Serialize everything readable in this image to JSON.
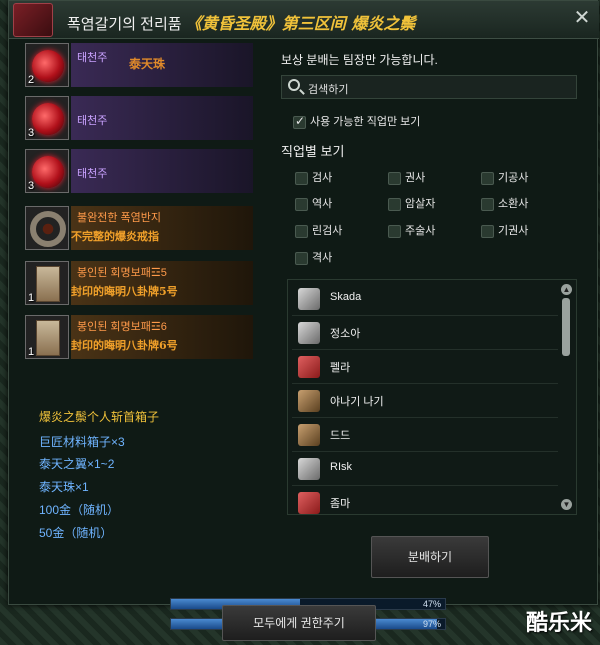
{
  "title": {
    "ko": "폭염갈기의 전리품",
    "zh": "《黄昏圣殿》第三区间 爆炎之鬃"
  },
  "loot": [
    {
      "qty": "2",
      "name": "태천주",
      "zh": "泰天珠"
    },
    {
      "qty": "3",
      "name": "태천주",
      "zh": ""
    },
    {
      "qty": "3",
      "name": "태천주",
      "zh": ""
    },
    {
      "qty": "",
      "name": "불완전한 폭염반지",
      "zh": "不完整的爆炎戒指"
    },
    {
      "qty": "1",
      "name": "봉인된 회명보패☲5",
      "zh": "封印的晦明八卦牌5号"
    },
    {
      "qty": "1",
      "name": "봉인된 회명보패☲6",
      "zh": "封印的晦明八卦牌6号"
    }
  ],
  "rewards": [
    "爆炎之鬃个人斩首箱子",
    "巨匠材料箱子×3",
    "泰天之翼×1~2",
    "泰天珠×1",
    "100金（随机）",
    "50金（随机）"
  ],
  "distribution": {
    "note": "보상 분배는 팀장만 가능합니다.",
    "search_placeholder": "검색하기",
    "available_only": "사용 가능한 직업만 보기",
    "section": "직업별 보기"
  },
  "classes": [
    "검사",
    "권사",
    "기공사",
    "역사",
    "암살자",
    "소환사",
    "린검사",
    "주술사",
    "기권사",
    "격사"
  ],
  "players": [
    "Skada",
    "정소아",
    "펠라",
    "야나기 나기",
    "드드",
    "RIsk",
    "좀마"
  ],
  "buttons": {
    "distribute": "분배하기",
    "give_all": "모두에게 권한주기"
  },
  "progress": [
    {
      "label": "47%",
      "value": 0.47
    },
    {
      "label": "97%",
      "value": 0.97
    }
  ],
  "watermark": "酷乐米",
  "colors": {
    "accent_gold": "#f0c23a",
    "reward_blue": "#6fb4ff",
    "purple": "#c9a2ff",
    "orange": "#ff9a4a"
  },
  "icons": {
    "close": "close-icon",
    "search": "search-icon",
    "chest": "treasure-chest-icon"
  }
}
